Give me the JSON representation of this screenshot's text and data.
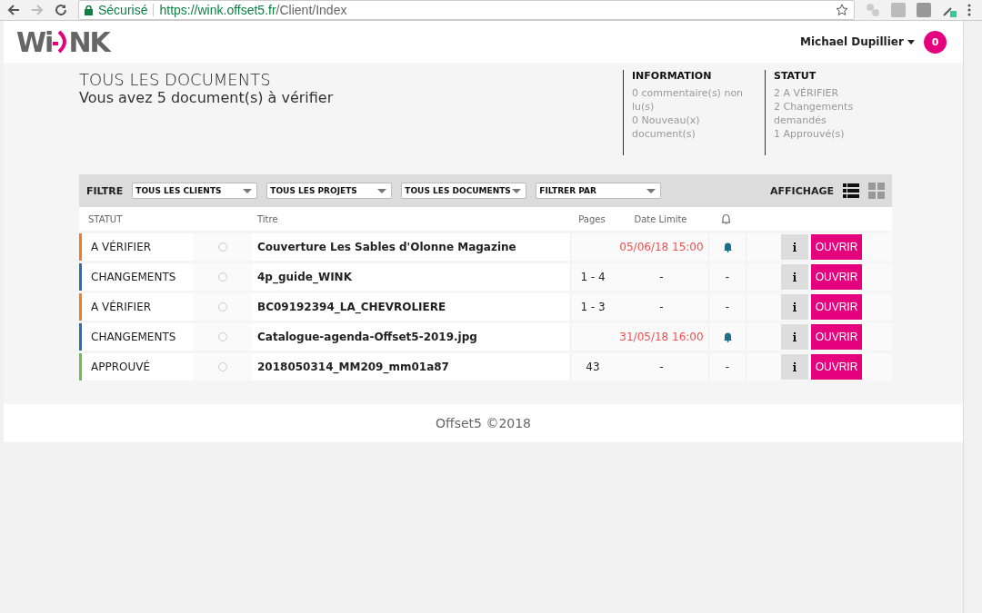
{
  "browser": {
    "secure_label": "Sécurisé",
    "url_host": "https://wink.offset5.fr",
    "url_path": "/Client/Index"
  },
  "header": {
    "logo_left": "Wi",
    "logo_right": "NK",
    "user": "Michael Dupillier",
    "badge": "0"
  },
  "summary": {
    "title": "TOUS LES DOCUMENTS",
    "subtitle": "Vous avez 5 document(s) à vérifier"
  },
  "info": {
    "heading": "INFORMATION",
    "lines": [
      "0 commentaire(s) non lu(s)",
      "0 Nouveau(x) document(s)"
    ]
  },
  "status": {
    "heading": "STATUT",
    "lines": [
      "2 A VÉRIFIER",
      "2 Changements demandés",
      "1 Approuvé(s)"
    ]
  },
  "filter": {
    "label": "FILTRE",
    "selects": [
      "TOUS LES CLIENTS",
      "TOUS LES PROJETS",
      "TOUS LES DOCUMENTS",
      "FILTRER PAR"
    ],
    "display_label": "AFFICHAGE",
    "views": [
      {
        "kind": "list",
        "selected": true
      },
      {
        "kind": "grid",
        "selected": false
      }
    ]
  },
  "table": {
    "columns": [
      "STATUT",
      "Titre",
      "Pages",
      "Date Limite"
    ],
    "rows": [
      {
        "status": "A VÉRIFIER",
        "color": "#f47b20",
        "title": "Couverture Les Sables d'Olonne Magazine",
        "pages": "",
        "date": "05/06/18 15:00",
        "alert": true,
        "notify": "",
        "action": "OUVRIR"
      },
      {
        "status": "CHANGEMENTS",
        "color": "#2a6ebb",
        "title": "4p_guide_WINK",
        "pages": "1 - 4",
        "date": "-",
        "alert": false,
        "notify": "-",
        "action": "OUVRIR"
      },
      {
        "status": "A VÉRIFIER",
        "color": "#f47b20",
        "title": "BC09192394_LA_CHEVROLIERE",
        "pages": "1 - 3",
        "date": "-",
        "alert": false,
        "notify": "-",
        "action": "OUVRIR"
      },
      {
        "status": "CHANGEMENTS",
        "color": "#2a6ebb",
        "title": "Catalogue-agenda-Offset5-2019.jpg",
        "pages": "",
        "date": "31/05/18 16:00",
        "alert": true,
        "notify": "",
        "action": "OUVRIR"
      },
      {
        "status": "APPROUVÉ",
        "color": "#6cc04a",
        "title": "2018050314_MM209_mm01a87",
        "pages": "43",
        "date": "-",
        "alert": false,
        "notify": "-",
        "action": "OUVRIR"
      }
    ]
  },
  "footer": "Offset5 ©2018"
}
